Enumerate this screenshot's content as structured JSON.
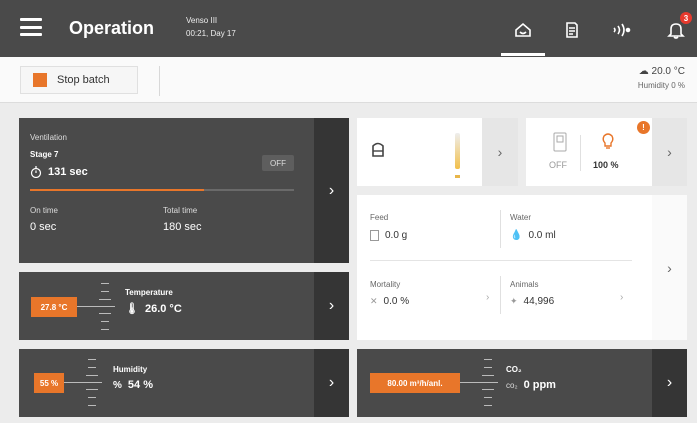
{
  "header": {
    "title": "Operation",
    "house": "Venso III",
    "time_day": "00:21, Day 17",
    "notification_count": "3"
  },
  "toolbar": {
    "stop_label": "Stop batch",
    "temperature": "20.0 °C",
    "humidity": "Humidity 0 %"
  },
  "ventilation": {
    "title": "Ventilation",
    "stage": "Stage 7",
    "duration": "131 sec",
    "state": "OFF",
    "progress": 0.66,
    "on_time_label": "On time",
    "on_time_value": "0 sec",
    "total_time_label": "Total time",
    "total_time_value": "180 sec"
  },
  "temperature": {
    "setpoint": "27.8 °C",
    "label": "Temperature",
    "value": "26.0 °C"
  },
  "humidity": {
    "setpoint": "55 %",
    "label": "Humidity",
    "value": "54 %"
  },
  "co2": {
    "setpoint": "80.00 m³/h/anl.",
    "label": "CO₂",
    "unit_prefix": "co₂",
    "value": "0 ppm"
  },
  "light": {
    "state": "OFF",
    "level": "100 %",
    "badge": "!"
  },
  "stats": {
    "feed_label": "Feed",
    "feed_value": "0.0 g",
    "water_label": "Water",
    "water_value": "0.0 ml",
    "mortality_label": "Mortality",
    "mortality_value": "0.0 %",
    "animals_label": "Animals",
    "animals_value": "44,996"
  },
  "colors": {
    "accent": "#e8762a",
    "dark": "#4a4a4a",
    "badge": "#e63a2e"
  }
}
